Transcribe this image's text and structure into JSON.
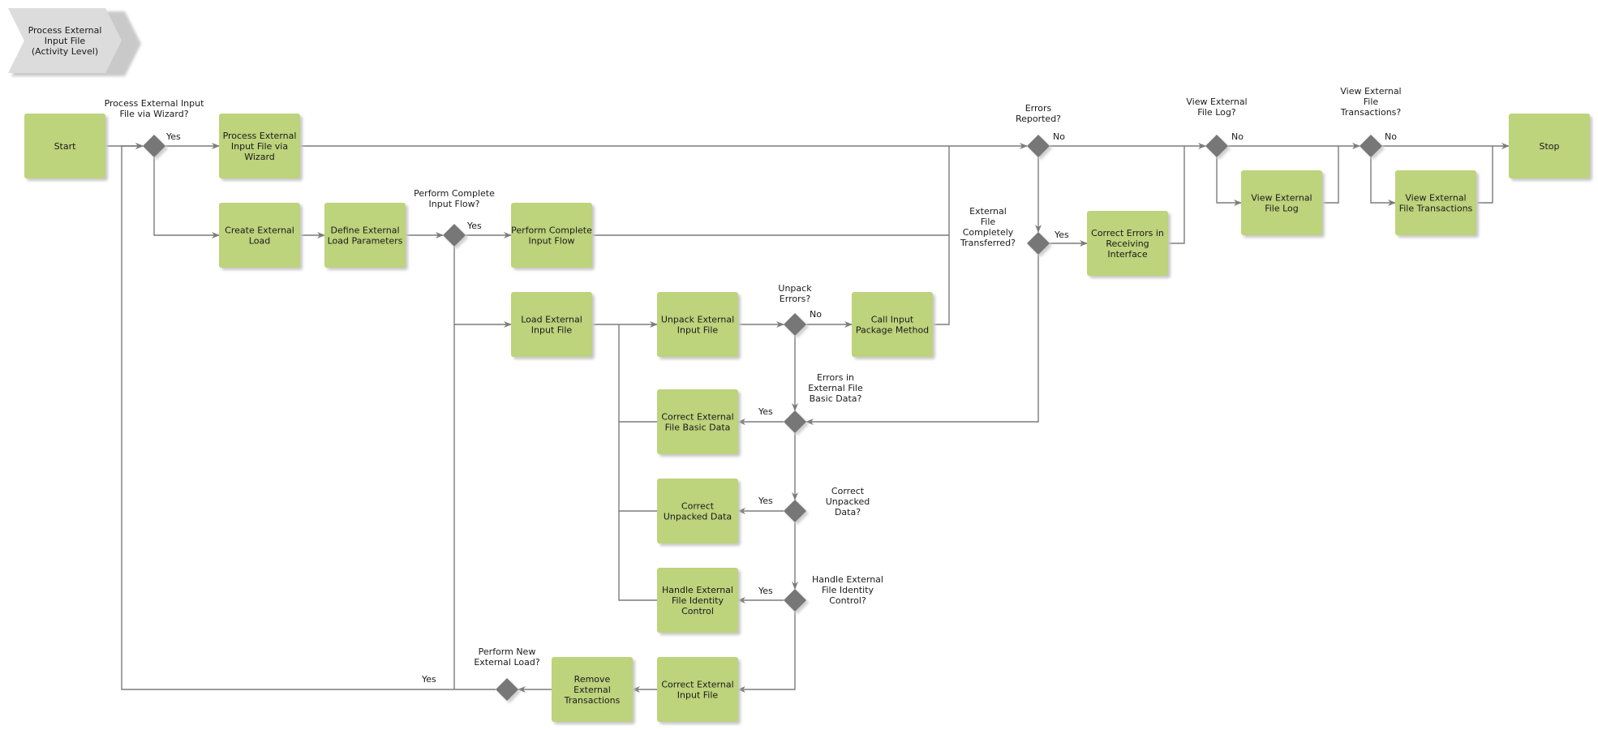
{
  "diagram": {
    "title": "Process External Input File (Activity Level)",
    "colors": {
      "task": "#bdd37c",
      "gateway": "#777777",
      "connector": "#7c7c7c",
      "header": "#dcdcdc"
    },
    "tasks": [
      {
        "id": "start",
        "label": "Start"
      },
      {
        "id": "wizard",
        "label": "Process External Input File via Wizard"
      },
      {
        "id": "create_load",
        "label": "Create External Load"
      },
      {
        "id": "define_params",
        "label": "Define External Load Parameters"
      },
      {
        "id": "complete_flow",
        "label": "Perform Complete Input Flow"
      },
      {
        "id": "load_file",
        "label": "Load External Input File"
      },
      {
        "id": "unpack",
        "label": "Unpack External Input File"
      },
      {
        "id": "call_package",
        "label": "Call Input Package Method"
      },
      {
        "id": "correct_basic",
        "label": "Correct External File Basic Data"
      },
      {
        "id": "correct_unpacked",
        "label": "Correct Unpacked Data"
      },
      {
        "id": "handle_identity",
        "label": "Handle External File Identity Control"
      },
      {
        "id": "correct_input",
        "label": "Correct External Input File"
      },
      {
        "id": "remove_trans",
        "label": "Remove External Transactions"
      },
      {
        "id": "correct_receiving",
        "label": "Correct Errors in Receiving Interface"
      },
      {
        "id": "view_log",
        "label": "View External File Log"
      },
      {
        "id": "view_trans",
        "label": "View External File Transactions"
      },
      {
        "id": "stop",
        "label": "Stop"
      }
    ],
    "gateways": [
      {
        "id": "g_wizard",
        "label": "Process External Input File via Wizard?"
      },
      {
        "id": "g_complete",
        "label": "Perform Complete Input Flow?"
      },
      {
        "id": "g_unpack_err",
        "label": "Unpack Errors?"
      },
      {
        "id": "g_basic",
        "label": "Errors in External File Basic Data?"
      },
      {
        "id": "g_unpacked",
        "label": "Correct Unpacked Data?"
      },
      {
        "id": "g_identity",
        "label": "Handle External File Identity Control?"
      },
      {
        "id": "g_new_load",
        "label": "Perform New External Load?"
      },
      {
        "id": "g_errors",
        "label": "Errors Reported?"
      },
      {
        "id": "g_transferred",
        "label": "External File Completely Transferred?"
      },
      {
        "id": "g_view_log",
        "label": "View External File Log?"
      },
      {
        "id": "g_view_trans",
        "label": "View External File Transactions?"
      }
    ],
    "branch_labels": [
      {
        "id": "b_wizard_yes",
        "text": "Yes"
      },
      {
        "id": "b_complete_yes",
        "text": "Yes"
      },
      {
        "id": "b_unpack_no",
        "text": "No"
      },
      {
        "id": "b_basic_yes",
        "text": "Yes"
      },
      {
        "id": "b_unpacked_yes",
        "text": "Yes"
      },
      {
        "id": "b_identity_yes",
        "text": "Yes"
      },
      {
        "id": "b_new_load_yes",
        "text": "Yes"
      },
      {
        "id": "b_errors_no",
        "text": "No"
      },
      {
        "id": "b_transferred_yes",
        "text": "Yes"
      },
      {
        "id": "b_view_log_no",
        "text": "No"
      },
      {
        "id": "b_view_trans_no",
        "text": "No"
      }
    ]
  }
}
